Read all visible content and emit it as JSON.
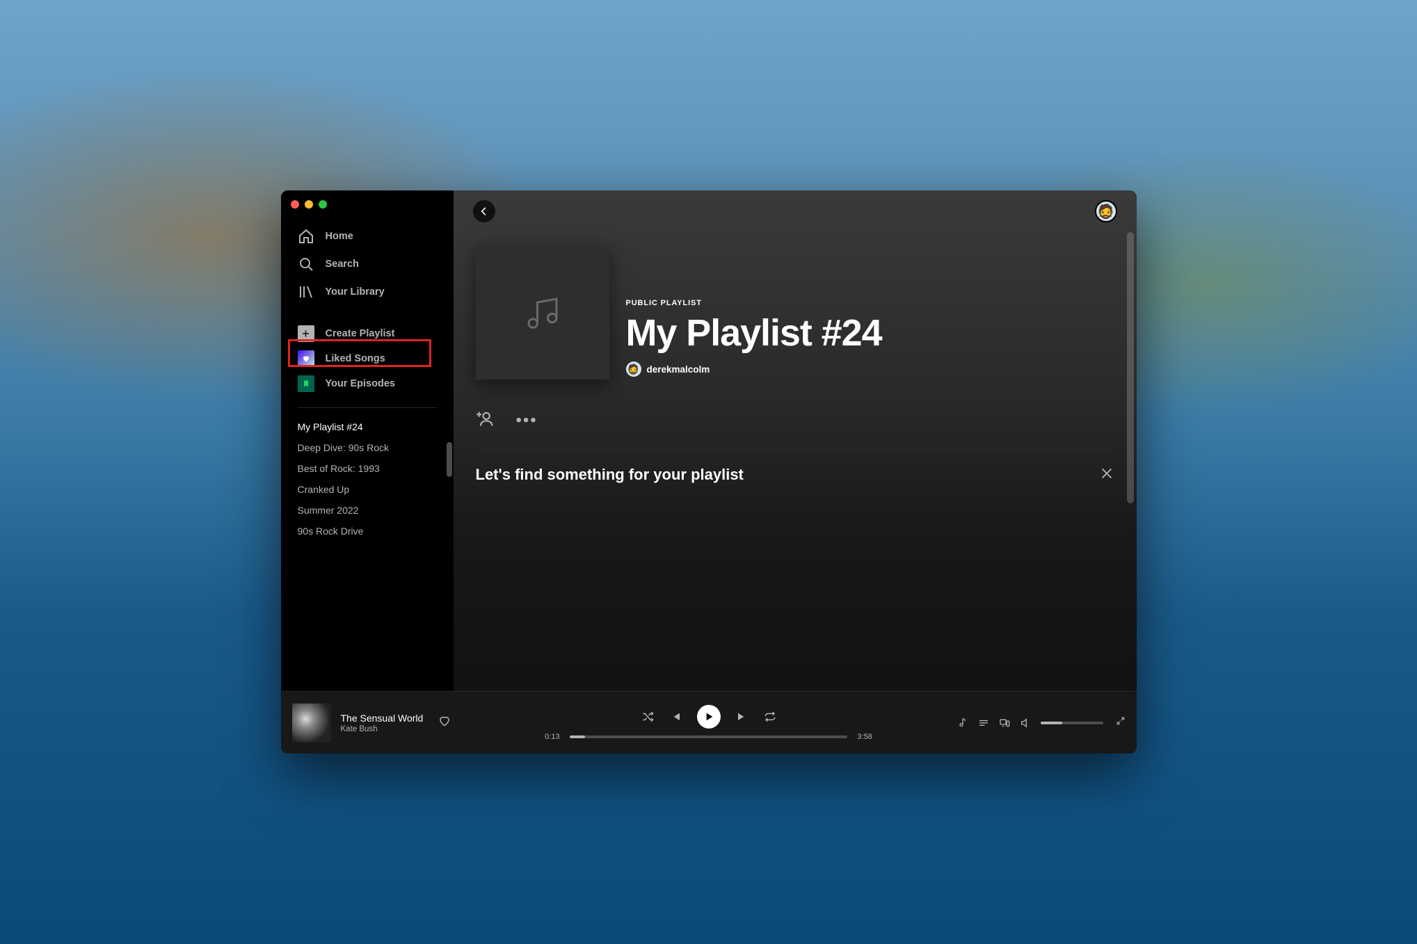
{
  "sidebar": {
    "nav": {
      "home": "Home",
      "search": "Search",
      "library": "Your Library"
    },
    "actions": {
      "create_playlist": "Create Playlist",
      "liked_songs": "Liked Songs",
      "your_episodes": "Your Episodes"
    },
    "playlists": [
      "My Playlist #24",
      "Deep Dive: 90s Rock",
      "Best of Rock: 1993",
      "Cranked Up",
      "Summer 2022",
      "90s Rock Drive"
    ],
    "active_playlist_index": 0
  },
  "content": {
    "tag": "PUBLIC PLAYLIST",
    "title": "My Playlist #24",
    "owner": "derekmalcolm",
    "find_prompt": "Let's find something for your playlist"
  },
  "now_playing": {
    "track": "The Sensual World",
    "artist": "Kate Bush",
    "elapsed": "0:13",
    "duration": "3:58",
    "progress_pct": 5.5,
    "volume_pct": 35
  }
}
